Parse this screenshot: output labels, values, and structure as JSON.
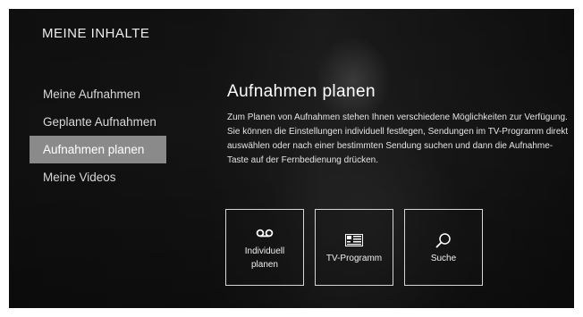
{
  "header": {
    "title": "MEINE INHALTE"
  },
  "nav": {
    "items": [
      {
        "label": "Meine Aufnahmen"
      },
      {
        "label": "Geplante Aufnahmen"
      },
      {
        "label": "Aufnahmen planen",
        "active": true
      },
      {
        "label": "Meine Videos"
      }
    ]
  },
  "main": {
    "title": "Aufnahmen planen",
    "description": "Zum Planen von Aufnahmen stehen Ihnen verschiedene Möglichkeiten zur Verfügung. Sie können die Einstellungen individuell festlegen, Sendungen im TV-Programm direkt auswählen oder nach einer bestimmten Sendung suchen und dann die Aufnahme-Taste auf der Fernbedienung drücken.",
    "tiles": [
      {
        "label": "Individuell\nplanen",
        "icon": "voicemail-icon"
      },
      {
        "label": "TV-Programm",
        "icon": "tv-guide-icon"
      },
      {
        "label": "Suche",
        "icon": "search-icon"
      }
    ]
  },
  "colors": {
    "background": "#141414",
    "active_item": "#8a8a8a",
    "text": "#ffffff"
  }
}
